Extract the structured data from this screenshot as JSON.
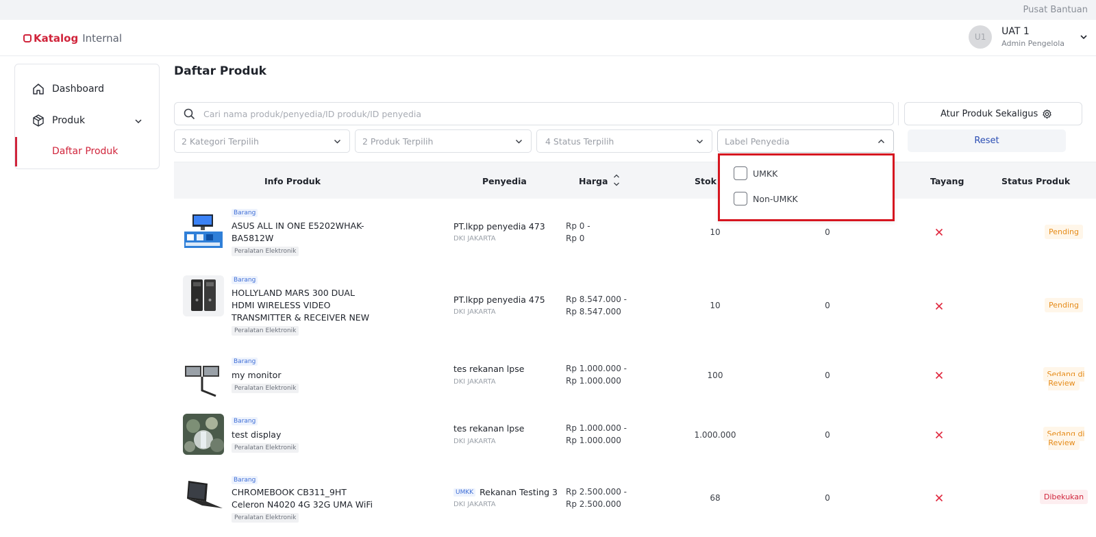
{
  "topbar": {
    "help": "Pusat Bantuan"
  },
  "header": {
    "brand": "Katalog",
    "brand_sub": "Internal"
  },
  "user": {
    "initials": "U1",
    "name": "UAT 1",
    "role": "Admin Pengelola"
  },
  "sidebar": {
    "items": [
      {
        "label": "Dashboard",
        "icon": "home-icon"
      },
      {
        "label": "Produk",
        "icon": "package-icon"
      }
    ],
    "sub_active": "Daftar Produk"
  },
  "page": {
    "title": "Daftar Produk"
  },
  "search": {
    "placeholder": "Cari nama produk/penyedia/ID produk/ID penyedia"
  },
  "bulk_button": "Atur Produk Sekaligus",
  "filters": {
    "category": "2 Kategori Terpilih",
    "product": "2 Produk Terpilih",
    "status": "4 Status Terpilih",
    "vendor_label": "Label Penyedia",
    "reset": "Reset"
  },
  "vendor_label_options": [
    "UMKK",
    "Non-UMKK"
  ],
  "table": {
    "headers": {
      "info": "Info Produk",
      "vendor": "Penyedia",
      "price": "Harga",
      "stock": "Stok",
      "shown": "Tayang",
      "status": "Status Produk"
    },
    "rows": [
      {
        "type": "Barang",
        "name": "ASUS ALL IN ONE E5202WHAK-BA5812W",
        "category": "Peralatan Elektronik",
        "vendor": "PT.lkpp penyedia 473",
        "vendor_badge": "",
        "location": "DKI JAKARTA",
        "price_min": "Rp 0 -",
        "price_max": "Rp 0",
        "stock": "10",
        "zero": "0",
        "status": "Pending"
      },
      {
        "type": "Barang",
        "name": "HOLLYLAND MARS 300 DUAL HDMI WIRELESS VIDEO TRANSMITTER & RECEIVER NEW",
        "category": "Peralatan Elektronik",
        "vendor": "PT.lkpp penyedia 475",
        "vendor_badge": "",
        "location": "DKI JAKARTA",
        "price_min": "Rp 8.547.000 -",
        "price_max": "Rp 8.547.000",
        "stock": "10",
        "zero": "0",
        "status": "Pending"
      },
      {
        "type": "Barang",
        "name": "my monitor",
        "category": "Peralatan Elektronik",
        "vendor": "tes rekanan lpse",
        "vendor_badge": "",
        "location": "DKI JAKARTA",
        "price_min": "Rp 1.000.000 -",
        "price_max": "Rp 1.000.000",
        "stock": "100",
        "zero": "0",
        "status": "Sedang di Review"
      },
      {
        "type": "Barang",
        "name": "test display",
        "category": "Peralatan Elektronik",
        "vendor": "tes rekanan lpse",
        "vendor_badge": "",
        "location": "DKI JAKARTA",
        "price_min": "Rp 1.000.000 -",
        "price_max": "Rp 1.000.000",
        "stock": "1.000.000",
        "zero": "0",
        "status": "Sedang di Review"
      },
      {
        "type": "Barang",
        "name": "CHROMEBOOK CB311_9HT Celeron N4020 4G 32G UMA WiFi",
        "category": "Peralatan Elektronik",
        "vendor": "Rekanan Testing 3",
        "vendor_badge": "UMKK",
        "location": "DKI JAKARTA",
        "price_min": "Rp 2.500.000 -",
        "price_max": "Rp 2.500.000",
        "stock": "68",
        "zero": "0",
        "status": "Dibekukan"
      }
    ]
  },
  "colors": {
    "brand": "#d0243b",
    "link": "#2a4db3",
    "highlight": "#d6151f"
  }
}
